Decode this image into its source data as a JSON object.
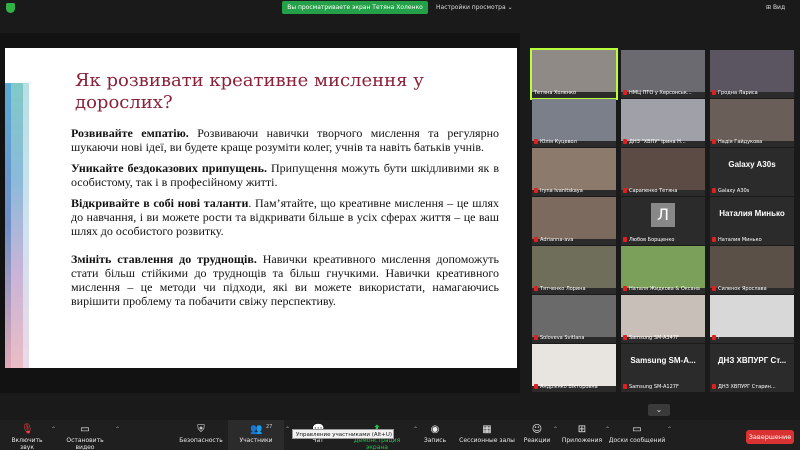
{
  "topbar": {
    "share_status": "Вы просматриваете экран Тетяна Холенко",
    "view_options": "Настройки просмотра",
    "view_label": "Вид"
  },
  "slide": {
    "title": "Як розвивати креативне мислення у дорослих?",
    "paragraphs": [
      {
        "bold": "Розвивайте емпатію.",
        "text": " Розвиваючи навички творчого мислення та регулярно шукаючи нові ідеї, ви будете краще розуміти колег, учнів та навіть батьків учнів."
      },
      {
        "bold": "Уникайте бездоказових припущень.",
        "text": " Припущення можуть бути шкідливими як в особистому, так і в професійному житті."
      },
      {
        "bold": "Відкривайте в собі нові таланти",
        "text": ". Пам’ятайте, що креативне мислення – це шлях до навчання, і ви можете рости та відкривати більше в усіх сферах життя – це ваш шлях до особистого розвитку."
      },
      {
        "bold": "Змініть ставлення до труднощів.",
        "text": " Навички креативного мислення допоможуть стати більш стійкими до труднощів та більш гнучкими. Навички креативного мислення – це методи чи підходи, які ви можете використати, намагаючись вирішити проблему та побачити свіжу перспективу."
      }
    ]
  },
  "gallery": [
    {
      "name": "Тетяна Холенко",
      "muted": false,
      "big": ""
    },
    {
      "name": "НМЦ ПТО у Херсонськ...",
      "muted": true,
      "big": ""
    },
    {
      "name": "Гродна Лариса",
      "muted": true,
      "big": ""
    },
    {
      "name": "Юлія Куцевол",
      "muted": true,
      "big": ""
    },
    {
      "name": "ДНЗ \"ХВПУ\" Ірина Н...",
      "muted": true,
      "big": ""
    },
    {
      "name": "Надія Гайдукова",
      "muted": true,
      "big": ""
    },
    {
      "name": "Iryna Ivanitskaya",
      "muted": true,
      "big": ""
    },
    {
      "name": "Сарапенко Тетяна",
      "muted": true,
      "big": ""
    },
    {
      "name": "Galaxy A30s",
      "muted": true,
      "big": "Galaxy A30s"
    },
    {
      "name": "Adrianna-ava",
      "muted": true,
      "big": ""
    },
    {
      "name": "Любов Борщенко",
      "muted": true,
      "big": "Л"
    },
    {
      "name": "Наталия Минько",
      "muted": true,
      "big": "Наталия Минько"
    },
    {
      "name": "Тятченко Лорина",
      "muted": true,
      "big": ""
    },
    {
      "name": "Наталя Жидкова & Оксана",
      "muted": true,
      "big": ""
    },
    {
      "name": "Силенок Ярослава",
      "muted": true,
      "big": ""
    },
    {
      "name": "Soloveva Svitlana",
      "muted": true,
      "big": ""
    },
    {
      "name": "Samsung SM-A347F",
      "muted": true,
      "big": ""
    },
    {
      "name": "ї",
      "muted": true,
      "big": ""
    },
    {
      "name": "Андрієнко Вікторовна",
      "muted": true,
      "big": ""
    },
    {
      "name": "Samsung SM-A127F",
      "muted": true,
      "big": "Samsung SM-A..."
    },
    {
      "name": "ДНЗ ХВПУРГ Старин...",
      "muted": true,
      "big": "ДНЗ ХВПУРГ Ст..."
    }
  ],
  "toolbar": {
    "unmute": "Включить звук",
    "stop_video": "Остановить видео",
    "security": "Безопасность",
    "participants": "Участники",
    "participants_count": "27",
    "chat": "Чат",
    "share_screen": "Демонстрация экрана",
    "record": "Запись",
    "breakout": "Сессионные залы",
    "reactions": "Реакции",
    "apps": "Приложения",
    "whiteboards": "Доски сообщений",
    "end": "Завершение",
    "tooltip": "Управление участниками (Alt+U)"
  },
  "colors": {
    "share_green": "#24a148",
    "title_maroon": "#8a2139",
    "end_red": "#d93232",
    "active_speaker": "#b7ff3a"
  }
}
